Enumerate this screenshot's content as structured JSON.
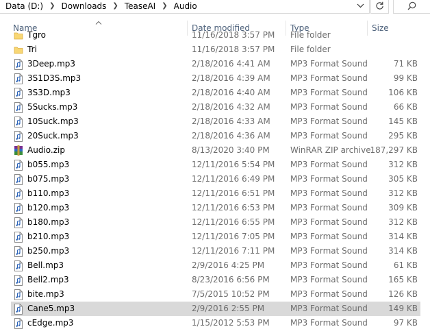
{
  "address": {
    "crumbs": [
      "Data (D:)",
      "Downloads",
      "TeaseAI",
      "Audio"
    ],
    "dropdown_icon": "chevron-down-icon",
    "refresh_icon": "refresh-icon",
    "search_icon": "search-icon"
  },
  "columns": {
    "name": "Name",
    "date": "Date modified",
    "type": "Type",
    "size": "Size"
  },
  "files": [
    {
      "name": "Tgro",
      "date": "11/16/2018 3:57 PM",
      "type": "File folder",
      "size": "",
      "icon": "folder-icon"
    },
    {
      "name": "Tri",
      "date": "11/16/2018 3:57 PM",
      "type": "File folder",
      "size": "",
      "icon": "folder-icon"
    },
    {
      "name": "3Deep.mp3",
      "date": "2/18/2016 4:41 AM",
      "type": "MP3 Format Sound",
      "size": "71 KB",
      "icon": "audio-file-icon"
    },
    {
      "name": "3S1D3S.mp3",
      "date": "2/18/2016 4:39 AM",
      "type": "MP3 Format Sound",
      "size": "99 KB",
      "icon": "audio-file-icon"
    },
    {
      "name": "3S3D.mp3",
      "date": "2/18/2016 4:40 AM",
      "type": "MP3 Format Sound",
      "size": "106 KB",
      "icon": "audio-file-icon"
    },
    {
      "name": "5Sucks.mp3",
      "date": "2/18/2016 4:32 AM",
      "type": "MP3 Format Sound",
      "size": "66 KB",
      "icon": "audio-file-icon"
    },
    {
      "name": "10Suck.mp3",
      "date": "2/18/2016 4:33 AM",
      "type": "MP3 Format Sound",
      "size": "145 KB",
      "icon": "audio-file-icon"
    },
    {
      "name": "20Suck.mp3",
      "date": "2/18/2016 4:36 AM",
      "type": "MP3 Format Sound",
      "size": "295 KB",
      "icon": "audio-file-icon"
    },
    {
      "name": "Audio.zip",
      "date": "8/13/2020 3:40 PM",
      "type": "WinRAR ZIP archive",
      "size": "187,297 KB",
      "icon": "winrar-archive-icon"
    },
    {
      "name": "b055.mp3",
      "date": "12/11/2016 5:54 PM",
      "type": "MP3 Format Sound",
      "size": "312 KB",
      "icon": "audio-file-icon"
    },
    {
      "name": "b075.mp3",
      "date": "12/11/2016 6:49 PM",
      "type": "MP3 Format Sound",
      "size": "305 KB",
      "icon": "audio-file-icon"
    },
    {
      "name": "b110.mp3",
      "date": "12/11/2016 6:51 PM",
      "type": "MP3 Format Sound",
      "size": "312 KB",
      "icon": "audio-file-icon"
    },
    {
      "name": "b120.mp3",
      "date": "12/11/2016 6:53 PM",
      "type": "MP3 Format Sound",
      "size": "309 KB",
      "icon": "audio-file-icon"
    },
    {
      "name": "b180.mp3",
      "date": "12/11/2016 6:55 PM",
      "type": "MP3 Format Sound",
      "size": "312 KB",
      "icon": "audio-file-icon"
    },
    {
      "name": "b210.mp3",
      "date": "12/11/2016 7:05 PM",
      "type": "MP3 Format Sound",
      "size": "314 KB",
      "icon": "audio-file-icon"
    },
    {
      "name": "b250.mp3",
      "date": "12/11/2016 7:11 PM",
      "type": "MP3 Format Sound",
      "size": "314 KB",
      "icon": "audio-file-icon"
    },
    {
      "name": "Bell.mp3",
      "date": "2/9/2016 4:25 PM",
      "type": "MP3 Format Sound",
      "size": "61 KB",
      "icon": "audio-file-icon"
    },
    {
      "name": "Bell2.mp3",
      "date": "8/23/2016 6:56 PM",
      "type": "MP3 Format Sound",
      "size": "165 KB",
      "icon": "audio-file-icon"
    },
    {
      "name": "bite.mp3",
      "date": "7/5/2015 10:52 PM",
      "type": "MP3 Format Sound",
      "size": "126 KB",
      "icon": "audio-file-icon"
    },
    {
      "name": "Cane5.mp3",
      "date": "2/9/2016 2:55 PM",
      "type": "MP3 Format Sound",
      "size": "149 KB",
      "icon": "audio-file-icon",
      "selected": true
    },
    {
      "name": "cEdge.mp3",
      "date": "1/15/2012 5:53 PM",
      "type": "MP3 Format Sound",
      "size": "97 KB",
      "icon": "audio-file-icon"
    }
  ],
  "colors": {
    "selection": "#d9d9d9",
    "header_text": "#4c607a",
    "secondary_text": "#6d6d6d",
    "folder": "#f8d775"
  }
}
